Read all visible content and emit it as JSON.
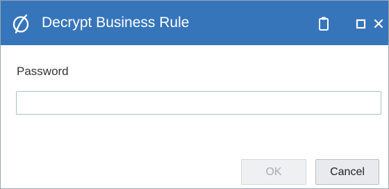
{
  "dialog": {
    "title": "Decrypt Business Rule",
    "colors": {
      "titlebar": "#3775ba",
      "title_text": "#ffffff"
    },
    "titlebar_icons": [
      "app-logo-icon",
      "clipboard-icon",
      "maximize-icon",
      "close-icon"
    ]
  },
  "form": {
    "password_label": "Password",
    "password_value": "",
    "password_placeholder": ""
  },
  "buttons": {
    "ok_label": "OK",
    "ok_enabled": false,
    "cancel_label": "Cancel"
  }
}
